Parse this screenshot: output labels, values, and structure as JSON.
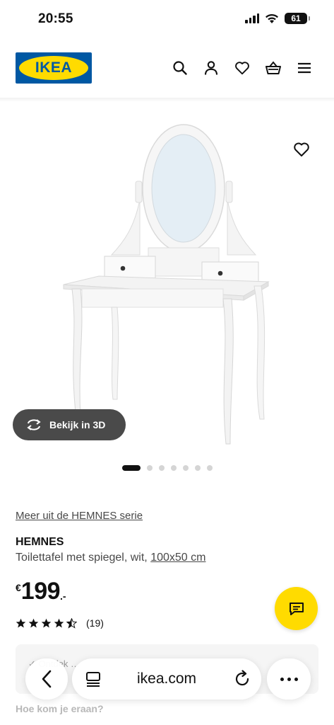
{
  "status_bar": {
    "time": "20:55",
    "battery": "61"
  },
  "header": {
    "logo_text": "IKEA",
    "icons": [
      "search-icon",
      "account-icon",
      "heart-icon",
      "basket-icon",
      "menu-icon"
    ]
  },
  "gallery": {
    "view_3d_label": "Bekijk in 3D",
    "image_count": 7,
    "active_index": 0
  },
  "product": {
    "series_link": "Meer uit de HEMNES serie",
    "name": "HEMNES",
    "description": "Toilettafel met spiegel, wit,",
    "dimensions": "100x50 cm",
    "price_currency": "€",
    "price_amount": "199",
    "price_suffix": ".-",
    "rating_value": 4.5,
    "review_count": "(19)"
  },
  "delivery_card": {
    "text": "✓ Ontdek …"
  },
  "bottom_question": "Hoe kom je eraan?",
  "browser": {
    "url": "ikea.com"
  },
  "colors": {
    "ikea_blue": "#0058a3",
    "ikea_yellow": "#ffdb00",
    "button_dark": "#4a4a4a"
  }
}
